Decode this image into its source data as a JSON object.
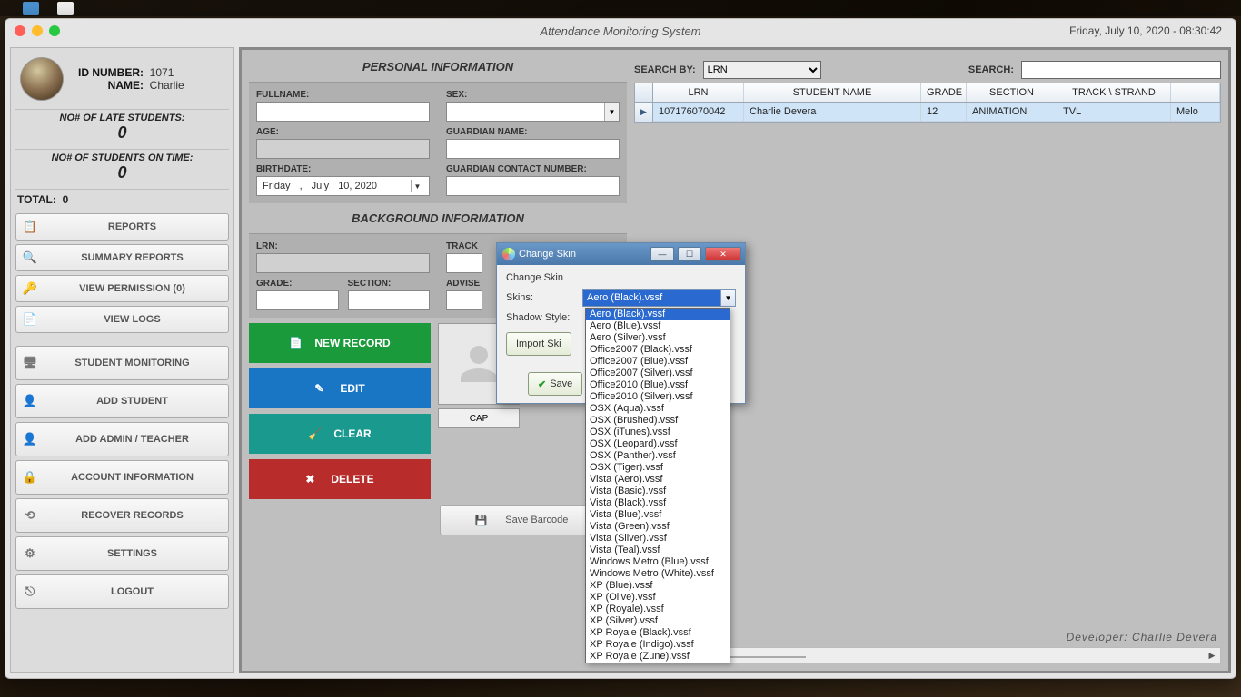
{
  "window": {
    "title": "Attendance Monitoring System",
    "datetime": "Friday, July  10, 2020 - 08:30:42"
  },
  "user": {
    "id_label": "ID NUMBER:",
    "id_value": "1071",
    "name_label": "NAME:",
    "name_value": "Charlie"
  },
  "stats": {
    "late_label": "NO# OF LATE STUDENTS:",
    "late_value": "0",
    "ontime_label": "NO# OF STUDENTS ON TIME:",
    "ontime_value": "0",
    "total_label": "TOTAL:",
    "total_value": "0"
  },
  "sidebar_buttons": {
    "reports": "REPORTS",
    "summary": "SUMMARY REPORTS",
    "viewperm": "VIEW PERMISSION (0)",
    "viewlogs": "VIEW LOGS",
    "monitoring": "STUDENT MONITORING",
    "addstudent": "ADD STUDENT",
    "addadmin": "ADD ADMIN / TEACHER",
    "account": "ACCOUNT INFORMATION",
    "recover": "RECOVER RECORDS",
    "settings": "SETTINGS",
    "logout": "LOGOUT"
  },
  "sections": {
    "personal": "PERSONAL INFORMATION",
    "background": "BACKGROUND INFORMATION"
  },
  "fields": {
    "fullname": "FULLNAME:",
    "sex": "SEX:",
    "age": "AGE:",
    "guardian": "GUARDIAN NAME:",
    "birthdate": "BIRTHDATE:",
    "guardian_contact": "GUARDIAN CONTACT NUMBER:",
    "lrn": "LRN:",
    "track": "TRACK",
    "grade": "GRADE:",
    "section": "SECTION:",
    "adviser": "ADVISE",
    "birthdate_value": {
      "weekday": "Friday",
      "sep": ",",
      "month": "July",
      "day": "10, 2020"
    }
  },
  "actions": {
    "new": "NEW RECORD",
    "edit": "EDIT",
    "clear": "CLEAR",
    "delete": "DELETE",
    "capture": "CAP",
    "barcode": "Save Barcode"
  },
  "search": {
    "by_label": "SEARCH BY:",
    "by_value": "LRN",
    "label": "SEARCH:"
  },
  "grid": {
    "headers": {
      "lrn": "LRN",
      "name": "STUDENT NAME",
      "grade": "GRADE",
      "section": "SECTION",
      "track": "TRACK \\ STRAND"
    },
    "row": {
      "lrn": "107176070042",
      "name": "Charlie Devera",
      "grade": "12",
      "section": "ANIMATION",
      "track": "TVL",
      "rest": "Melo"
    }
  },
  "developer": "Developer: Charlie Devera",
  "modal": {
    "title": "Change Skin",
    "group": "Change Skin",
    "skins_label": "Skins:",
    "shadow_label": "Shadow Style:",
    "selected_skin": "Aero (Black).vssf",
    "import": "Import Ski",
    "save": "Save",
    "options": [
      "Aero (Black).vssf",
      "Aero (Blue).vssf",
      "Aero (Silver).vssf",
      "Office2007 (Black).vssf",
      "Office2007 (Blue).vssf",
      "Office2007 (Silver).vssf",
      "Office2010 (Blue).vssf",
      "Office2010 (Silver).vssf",
      "OSX (Aqua).vssf",
      "OSX (Brushed).vssf",
      "OSX (iTunes).vssf",
      "OSX (Leopard).vssf",
      "OSX (Panther).vssf",
      "OSX (Tiger).vssf",
      "Vista (Aero).vssf",
      "Vista (Basic).vssf",
      "Vista (Black).vssf",
      "Vista (Blue).vssf",
      "Vista (Green).vssf",
      "Vista (Silver).vssf",
      "Vista (Teal).vssf",
      "Windows Metro (Blue).vssf",
      "Windows Metro (White).vssf",
      "XP (Blue).vssf",
      "XP (Olive).vssf",
      "XP (Royale).vssf",
      "XP (Silver).vssf",
      "XP Royale (Black).vssf",
      "XP Royale (Indigo).vssf",
      "XP Royale (Zune).vssf"
    ]
  }
}
